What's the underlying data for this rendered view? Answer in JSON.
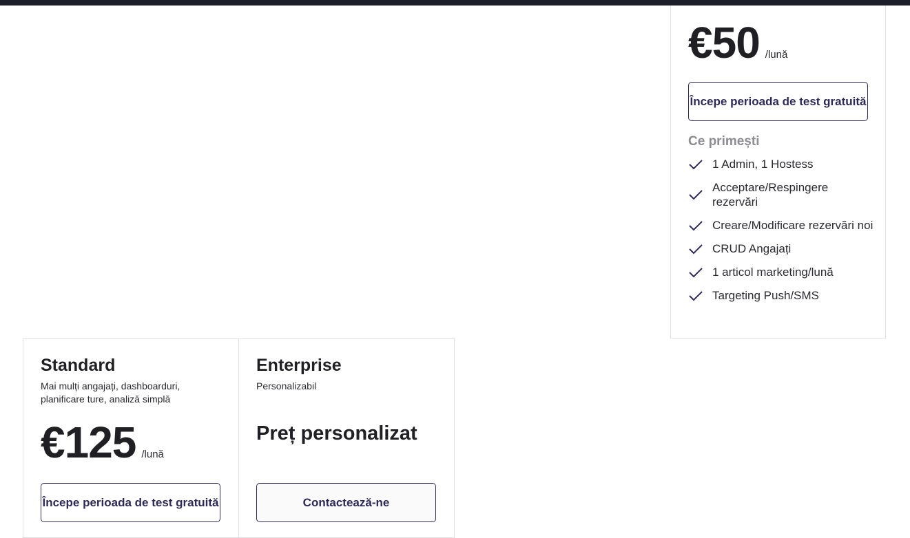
{
  "plans": {
    "basic": {
      "price": "€50",
      "period": "/lună",
      "cta_label": "Începe perioada de test gratuită",
      "features_title": "Ce primești",
      "features": [
        "1 Admin, 1 Hostess",
        "Acceptare/Respingere rezervări",
        "Creare/Modificare rezervări noi",
        "CRUD Angajați",
        "1 articol marketing/lună",
        "Targeting Push/SMS"
      ]
    },
    "standard": {
      "name": "Standard",
      "description": "Mai mulți angajați, dashboarduri, planificare ture, analiză simplă",
      "price": "€125",
      "period": "/lună",
      "cta_label": "Începe perioada de test gratuită"
    },
    "enterprise": {
      "name": "Enterprise",
      "description": "Personalizabil",
      "price": "Preț personalizat",
      "cta_label": "Contactează-ne"
    }
  },
  "colors": {
    "accent": "#2d2a57",
    "top_bar": "#1c1f2a",
    "border": "#e2e2e6",
    "muted_heading": "#8c8c92"
  },
  "icons": {
    "feature": "check-icon"
  }
}
